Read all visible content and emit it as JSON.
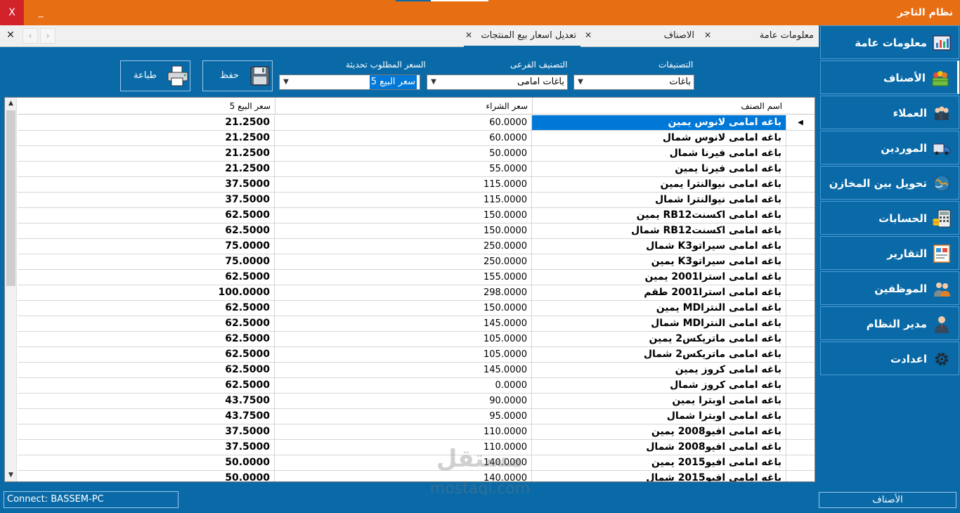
{
  "titlebar": {
    "title": "نظام التاجر",
    "close": "X",
    "minimize": "_"
  },
  "tabsbar": {
    "close_all": "✕",
    "prev": "‹",
    "next": "›",
    "tabs": [
      {
        "label": "معلومات عامة",
        "close": "✕"
      },
      {
        "label": "الاصناف",
        "close": "✕"
      },
      {
        "label": "تعديل اسعار بيع المنتجات",
        "close": "✕"
      }
    ]
  },
  "sidebar": {
    "items": [
      {
        "label": "معلومات عامة",
        "icon": "info-chart-icon"
      },
      {
        "label": "الأصناف",
        "icon": "products-icon"
      },
      {
        "label": "العملاء",
        "icon": "customers-icon"
      },
      {
        "label": "الموردين",
        "icon": "truck-icon"
      },
      {
        "label": "تحويل بين المخازن",
        "icon": "globe-transfer-icon"
      },
      {
        "label": "الحسابات",
        "icon": "calculator-icon"
      },
      {
        "label": "التقارير",
        "icon": "report-icon"
      },
      {
        "label": "الموظفين",
        "icon": "employees-icon"
      },
      {
        "label": "مدير النظام",
        "icon": "admin-icon"
      },
      {
        "label": "اعدادت",
        "icon": "gear-icon"
      }
    ]
  },
  "toolbar": {
    "print_label": "طباعة",
    "save_label": "حفظ",
    "price_label": "السعر المطلوب تحديثة",
    "price_value": "سعر البيع 5",
    "subcat_label": "التصنيف الفرعى",
    "subcat_value": "باغات امامى",
    "cat_label": "التصنيفات",
    "cat_value": "باغات"
  },
  "grid": {
    "headers": {
      "name": "اسم الصنف",
      "buy": "سعر الشراء",
      "price": "سعر البيع 5"
    },
    "rows": [
      {
        "name": "باغه امامى لانوس يمين",
        "buy": "60.0000",
        "price": "21.2500"
      },
      {
        "name": "باغه امامى لانوس شمال",
        "buy": "60.0000",
        "price": "21.2500"
      },
      {
        "name": "باغه امامى فيرنا شمال",
        "buy": "50.0000",
        "price": "21.2500"
      },
      {
        "name": "باغه امامى فيرنا يمين",
        "buy": "55.0000",
        "price": "21.2500"
      },
      {
        "name": "باغه امامى نيوالنترا يمين",
        "buy": "115.0000",
        "price": "37.5000"
      },
      {
        "name": "باغه امامى نيوالنترا شمال",
        "buy": "115.0000",
        "price": "37.5000"
      },
      {
        "name": "باغه امامى اكسنتRB12 يمين",
        "buy": "150.0000",
        "price": "62.5000"
      },
      {
        "name": "باغه امامى اكسنتRB12 شمال",
        "buy": "150.0000",
        "price": "62.5000"
      },
      {
        "name": "باغه امامى سيراتوK3 شمال",
        "buy": "250.0000",
        "price": "75.0000"
      },
      {
        "name": "باغه امامى سيراتوK3 يمين",
        "buy": "250.0000",
        "price": "75.0000"
      },
      {
        "name": "باغه امامى استرا2001 يمين",
        "buy": "155.0000",
        "price": "62.5000"
      },
      {
        "name": "باغه امامى استرا2001 طقم",
        "buy": "298.0000",
        "price": "100.0000"
      },
      {
        "name": "باغه امامى النتراMD يمين",
        "buy": "150.0000",
        "price": "62.5000"
      },
      {
        "name": "باغه امامى النتراMD شمال",
        "buy": "145.0000",
        "price": "62.5000"
      },
      {
        "name": "باغه امامى ماتريكس2 يمين",
        "buy": "105.0000",
        "price": "62.5000"
      },
      {
        "name": "باغه امامى ماتريكس2 شمال",
        "buy": "105.0000",
        "price": "62.5000"
      },
      {
        "name": "باغه امامى كروز يمين",
        "buy": "145.0000",
        "price": "62.5000"
      },
      {
        "name": "باغه امامى كروز شمال",
        "buy": "0.0000",
        "price": "62.5000"
      },
      {
        "name": "باغه امامى اوبترا يمين",
        "buy": "90.0000",
        "price": "43.7500"
      },
      {
        "name": "باغه امامى اوبترا شمال",
        "buy": "95.0000",
        "price": "43.7500"
      },
      {
        "name": "باغه امامى افيو2008 يمين",
        "buy": "110.0000",
        "price": "37.5000"
      },
      {
        "name": "باغه امامى افيو2008 شمال",
        "buy": "110.0000",
        "price": "37.5000"
      },
      {
        "name": "باغه امامى افيو2015 يمين",
        "buy": "140.0000",
        "price": "50.0000"
      },
      {
        "name": "باغه امامى افيو2015 شمال",
        "buy": "140.0000",
        "price": "50.0000"
      }
    ]
  },
  "status": {
    "connection": "Connect: BASSEM-PC",
    "section": "الأصناف"
  },
  "watermark": {
    "word": "مستقل",
    "url": "mostaql.com"
  },
  "colors": {
    "titlebar": "#e86e14",
    "close": "#d2232a",
    "background": "#0a6aa8",
    "selection": "#0078d7"
  }
}
